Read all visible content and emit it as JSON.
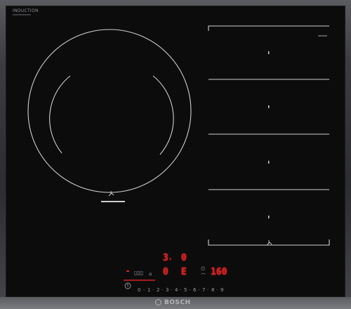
{
  "cooktop": {
    "badge_line1": "INDUCTION",
    "brand": "BOSCH"
  },
  "display": {
    "left_power": "3",
    "left_power_suffix": "↓",
    "right_power": "0",
    "left_lower": "0",
    "right_lower": "E",
    "timer_value": "160"
  },
  "slider": {
    "labels": [
      "0",
      "·",
      "1",
      "·",
      "2",
      "·",
      "3",
      "·",
      "4",
      "·",
      "5",
      "·",
      "6",
      "·",
      "7",
      "·",
      "8",
      "·",
      "9"
    ]
  },
  "colors": {
    "led_red": "#d42323",
    "glass": "#0c0c0d",
    "zone_line": "#c8c8c8"
  },
  "icons": {
    "power": "power-icon",
    "zone_marker": "pan-icon",
    "lock": "lock-icon"
  }
}
